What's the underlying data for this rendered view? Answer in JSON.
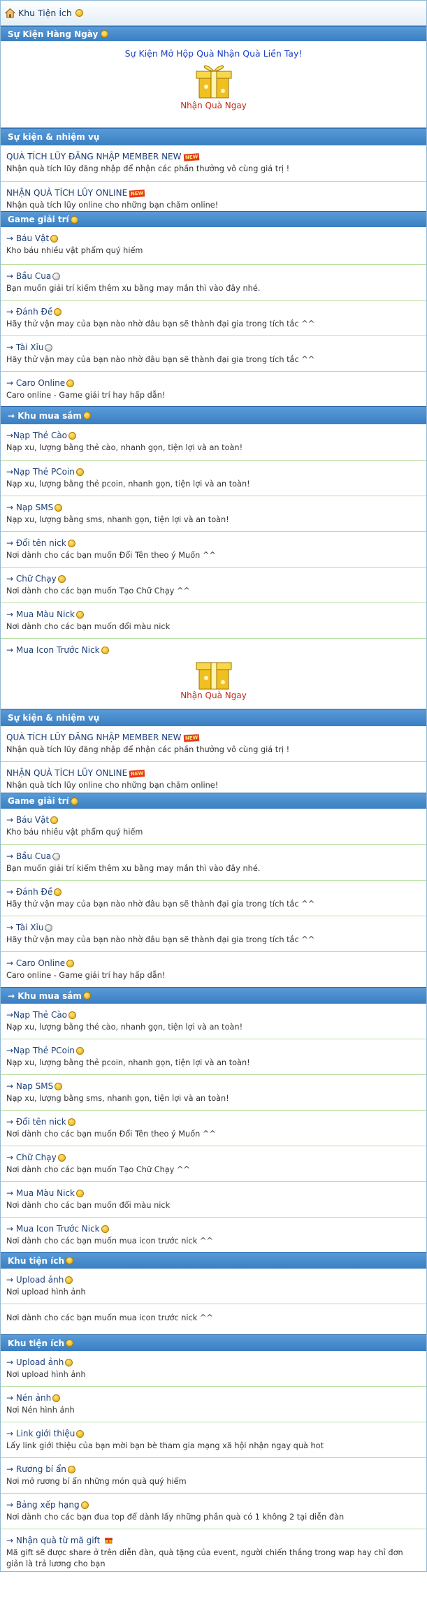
{
  "header": {
    "title": "Khu Tiện Ích"
  },
  "daily": {
    "title": "Sự Kiện Hàng Ngày",
    "event_link": "Sự Kiện Mở Hộp Quà Nhận Quà Liền Tay!",
    "gift_caption": "Nhận Quà Ngay",
    "gift_caption_2": "Nhận Quà Ngay"
  },
  "new_badge": "NEW",
  "sections": {
    "events": "Sự kiện & nhiệm vụ",
    "games": "Game giải trí",
    "shop": "→ Khu mua sắm",
    "utilities": "Khu tiện ích"
  },
  "events_items": [
    {
      "title": "QUÀ TÍCH LŨY ĐĂNG NHẬP MEMBER NEW",
      "desc": "Nhận quà tích lũy đăng nhập để nhận các phần thưởng vô cùng giá trị !"
    },
    {
      "title": "NHẬN QUÀ TÍCH LŨY ONLINE",
      "desc": "Nhận quà tích lũy online cho những bạn chăm online!"
    }
  ],
  "games_items": [
    {
      "title": "→ Báu Vật",
      "desc": "Kho báu nhiều vật phẩm quý hiếm"
    },
    {
      "title": "→ Bầu Cua",
      "desc": "Bạn muốn giải trí kiếm thêm xu bằng may mắn thì vào đây nhé."
    },
    {
      "title": "→ Đánh Đề",
      "desc": "Hãy thử vận may của bạn nào nhờ đâu bạn sẽ thành đại gia trong tích tắc ^^"
    },
    {
      "title": "→ Tài Xỉu",
      "desc": "Hãy thử vận may của bạn nào nhờ đâu bạn sẽ thành đại gia trong tích tắc ^^"
    },
    {
      "title": "→ Caro Online",
      "desc": "Caro online - Game giải trí hay hấp dẫn!"
    }
  ],
  "shop_items_1": [
    {
      "title": "→Nạp Thẻ Cào",
      "desc": "Nạp xu, lượng bằng thẻ cào, nhanh gọn, tiện lợi và an toàn!"
    },
    {
      "title": "→Nạp Thẻ PCoin",
      "desc": "Nạp xu, lượng bằng thẻ pcoin, nhanh gọn, tiện lợi và an toàn!"
    },
    {
      "title": "→ Nạp SMS",
      "desc": "Nạp xu, lượng bằng sms, nhanh gọn, tiện lợi và an toàn!"
    },
    {
      "title": "→ Đổi tên nick",
      "desc": "Nơi dành cho các bạn muốn Đổi Tên theo ý Muốn ^^"
    },
    {
      "title": "→ Chữ Chạy",
      "desc": "Nơi dành cho các bạn muốn Tạo Chữ Chạy ^^"
    },
    {
      "title": "→ Mua Màu Nick",
      "desc": "Nơi dành cho các bạn muốn đổi màu nick"
    },
    {
      "title": "→ Mua Icon Trước Nick",
      "desc": ""
    }
  ],
  "shop_items_2": [
    {
      "title": "→Nạp Thẻ Cào",
      "desc": "Nạp xu, lượng bằng thẻ cào, nhanh gọn, tiện lợi và an toàn!"
    },
    {
      "title": "→Nạp Thẻ PCoin",
      "desc": "Nạp xu, lượng bằng thẻ pcoin, nhanh gọn, tiện lợi và an toàn!"
    },
    {
      "title": "→ Nạp SMS",
      "desc": "Nạp xu, lượng bằng sms, nhanh gọn, tiện lợi và an toàn!"
    },
    {
      "title": "→ Đổi tên nick",
      "desc": "Nơi dành cho các bạn muốn Đổi Tên theo ý Muốn ^^"
    },
    {
      "title": "→ Chữ Chạy",
      "desc": "Nơi dành cho các bạn muốn Tạo Chữ Chạy ^^"
    },
    {
      "title": "→ Mua Màu Nick",
      "desc": "Nơi dành cho các bạn muốn đổi màu nick"
    },
    {
      "title": "→ Mua Icon Trước Nick",
      "desc": "Nơi dành cho các bạn muốn mua icon trước nick ^^"
    }
  ],
  "util_items_1": [
    {
      "title": "→ Upload ảnh",
      "desc": "Nơi upload hình ảnh"
    },
    {
      "title": "",
      "desc": "Nơi dành cho các bạn muốn mua icon trước nick ^^"
    }
  ],
  "util_items_2": [
    {
      "title": "→ Upload ảnh",
      "desc": "Nơi upload hình ảnh"
    },
    {
      "title": "→ Nén ảnh",
      "desc": "Nơi Nén hình ảnh"
    },
    {
      "title": "→ Link giới thiệu",
      "desc": "Lấy link giới thiệu của bạn mời bạn bè tham gia mạng xã hội nhận ngay quà hot"
    },
    {
      "title": "→ Rương bí ẩn",
      "desc": "Nơi mở rương bí ẩn những món quà quý hiếm"
    },
    {
      "title": "→ Bảng xếp hạng",
      "desc": "Nơi dành cho các bạn đua top để dành lấy những phần quà có 1 không 2 tại diễn đàn"
    },
    {
      "title": "→ Nhận quà từ mã gift",
      "desc": "Mã gift sẽ được share ở trên diễn đàn, quà tặng của event, người chiến thắng trong wap hay chỉ đơn giản là trả lương cho bạn"
    }
  ]
}
